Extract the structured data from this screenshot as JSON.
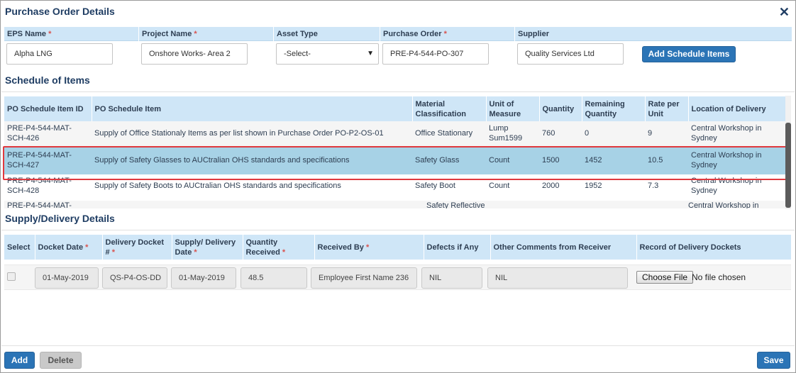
{
  "modal": {
    "title": "Purchase Order Details",
    "close_glyph": "✕"
  },
  "header_fields": {
    "eps_name": {
      "label": "EPS Name",
      "required": "*",
      "value": "Alpha LNG"
    },
    "project_name": {
      "label": "Project Name",
      "required": "*",
      "value": "Onshore  Works- Area 2"
    },
    "asset_type": {
      "label": "Asset Type",
      "value": "-Select-"
    },
    "purchase_order": {
      "label": "Purchase Order",
      "required": "*",
      "value": "PRE-P4-544-PO-307"
    },
    "supplier": {
      "label": "Supplier",
      "value": "Quality Services Ltd"
    },
    "add_schedule_items_label": "Add Schedule Items"
  },
  "schedule": {
    "title": "Schedule of Items",
    "columns": {
      "id": "PO Schedule Item ID",
      "item": "PO Schedule Item",
      "material": "Material Classification",
      "uom": "Unit of Measure",
      "quantity": "Quantity",
      "remaining": "Remaining Quantity",
      "rate": "Rate per Unit",
      "location": "Location of Delivery"
    },
    "rows": [
      {
        "id": "PRE-P4-544-MAT-SCH-426",
        "item": "Supply of Office Stationaly Items as per list shown in Purchase Order PO-P2-OS-01",
        "material": "Office Stationary",
        "uom": "Lump Sum1599",
        "quantity": "760",
        "remaining": "0",
        "rate": "9",
        "location": "Central Workshop in Sydney"
      },
      {
        "id": "PRE-P4-544-MAT-SCH-427",
        "item": "Supply of Safety Glasses to AUCtralian OHS standards and specifications",
        "material": "Safety Glass",
        "uom": "Count",
        "quantity": "1500",
        "remaining": "1452",
        "rate": "10.5",
        "location": "Central Workshop in Sydney"
      },
      {
        "id": "PRE-P4-544-MAT-SCH-428",
        "item": "Supply of Safety Boots to AUCtralian OHS standards and specifications",
        "material": "Safety Boot",
        "uom": "Count",
        "quantity": "2000",
        "remaining": "1952",
        "rate": "7.3",
        "location": "Central Workshop in Sydney"
      },
      {
        "id": "PRE-P4-544-MAT-",
        "item": "",
        "material": "Safety Reflective",
        "uom": "",
        "quantity": "",
        "remaining": "",
        "rate": "",
        "location": "Central Workshop in"
      }
    ]
  },
  "delivery": {
    "title": "Supply/Delivery Details",
    "columns": {
      "select": "Select",
      "docket_date": "Docket Date",
      "docket_no": "Delivery Docket #",
      "delivery_date": "Supply/ Delivery Date",
      "qty_received": "Quantity Received",
      "received_by": "Received By",
      "defects": "Defects if Any",
      "comments": "Other Comments from Receiver",
      "record": "Record of Delivery Dockets"
    },
    "required_mark": "*",
    "row": {
      "docket_date": "01-May-2019",
      "docket_no": "QS-P4-OS-DD",
      "delivery_date": "01-May-2019",
      "qty_received": "48.5",
      "received_by": "Employee First Name 236",
      "defects": "NIL",
      "comments": "NIL",
      "choose_file": "Choose File",
      "no_file": "No file chosen"
    }
  },
  "footer": {
    "add_label": "Add",
    "delete_label": "Delete",
    "save_label": "Save"
  },
  "colors": {
    "accent": "#2b74b6",
    "header_bg": "#cfe6f7",
    "highlight_row": "#a7d2e6",
    "highlight_border": "#e0393e"
  }
}
